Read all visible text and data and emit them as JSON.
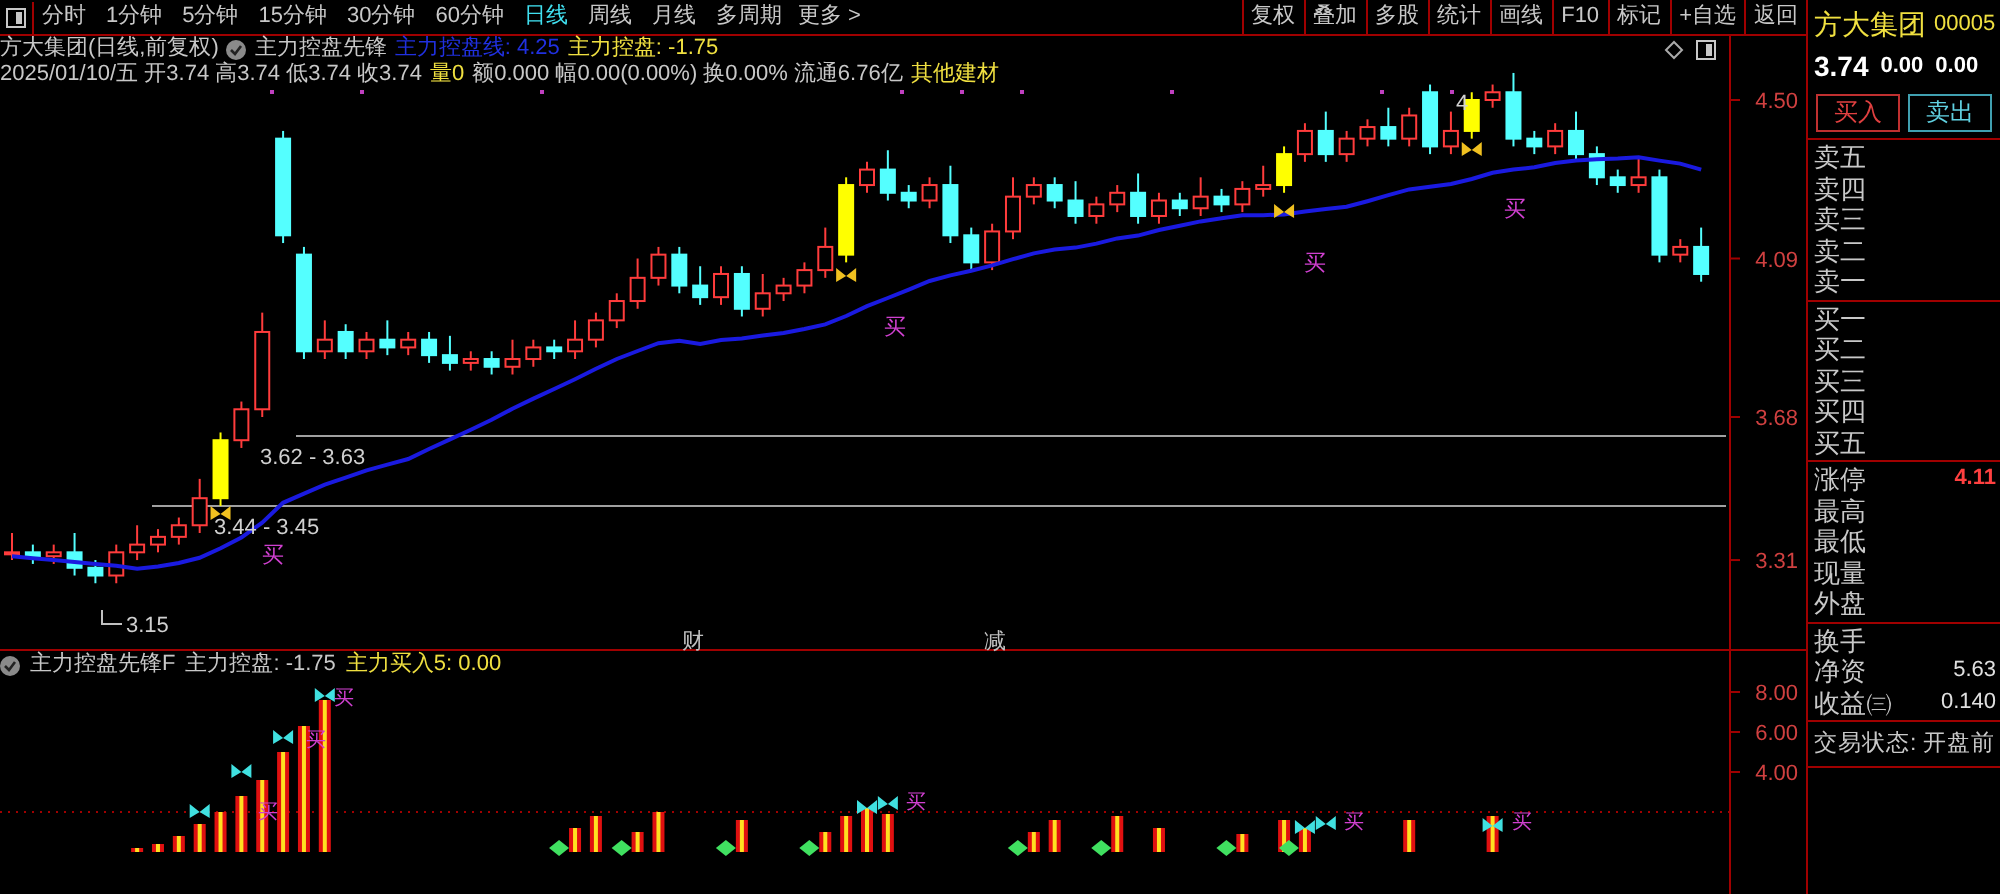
{
  "toolbar": {
    "tabs": [
      {
        "label": "分时",
        "selected": false
      },
      {
        "label": "1分钟",
        "selected": false
      },
      {
        "label": "5分钟",
        "selected": false
      },
      {
        "label": "15分钟",
        "selected": false
      },
      {
        "label": "30分钟",
        "selected": false
      },
      {
        "label": "60分钟",
        "selected": false
      },
      {
        "label": "日线",
        "selected": true
      },
      {
        "label": "周线",
        "selected": false
      },
      {
        "label": "月线",
        "selected": false
      },
      {
        "label": "多周期",
        "selected": false
      }
    ],
    "more": "更多 >",
    "buttons": [
      "复权",
      "叠加",
      "多股",
      "统计",
      "画线",
      "F10",
      "标记",
      "+自选",
      "返回"
    ]
  },
  "chart_header": {
    "title": "方大集团(日线,前复权)",
    "indicator": "主力控盘先锋",
    "line_value": "主力控盘线: 4.25",
    "value": "主力控盘: -1.75"
  },
  "bar_info": {
    "text": "2025/01/10/五 开3.74 高3.74 低3.74 收3.74",
    "volume": "量0",
    "rest": "额0.000 幅0.00(0.00%) 换0.00% 流通6.76亿",
    "industry": "其他建材"
  },
  "price_axis": [
    "4.50",
    "4.09",
    "3.68",
    "3.31"
  ],
  "annotations": [
    {
      "kind": "price_label",
      "text": "3.15"
    },
    {
      "kind": "price_label",
      "text": "3.62 - 3.63"
    },
    {
      "kind": "price_label",
      "text": "3.44 - 3.45"
    },
    {
      "kind": "price_label",
      "text": "4"
    },
    {
      "kind": "signal",
      "text": "买"
    },
    {
      "kind": "signal",
      "text": "买"
    },
    {
      "kind": "signal",
      "text": "买"
    },
    {
      "kind": "signal",
      "text": "买"
    },
    {
      "kind": "event",
      "text": "财"
    },
    {
      "kind": "event",
      "text": "减"
    }
  ],
  "sub_chart": {
    "indicator": "主力控盘先锋F",
    "value": "主力控盘: -1.75",
    "buy_value": "主力买入5: 0.00",
    "axis": [
      "8.00",
      "6.00",
      "4.00"
    ],
    "signals": [
      "买",
      "买",
      "买",
      "买",
      "买",
      "买"
    ]
  },
  "quote_panel": {
    "name": "方大集团",
    "code": "00005",
    "price": "3.74",
    "change": "0.00",
    "percent": "0.00",
    "buy_button": "买入",
    "sell_button": "卖出",
    "asks": [
      "卖五",
      "卖四",
      "卖三",
      "卖二",
      "卖一"
    ],
    "bids": [
      "买一",
      "买二",
      "买三",
      "买四",
      "买五"
    ],
    "stats": [
      {
        "label": "涨停",
        "value": "4.11"
      },
      {
        "label": "最高"
      },
      {
        "label": "最低"
      },
      {
        "label": "现量"
      },
      {
        "label": "外盘"
      }
    ],
    "fundamentals": [
      {
        "label": "换手"
      },
      {
        "label": "净资",
        "value": "5.63"
      },
      {
        "label": "收益㈢",
        "value": "0.140"
      }
    ],
    "status": "交易状态: 开盘前"
  }
}
